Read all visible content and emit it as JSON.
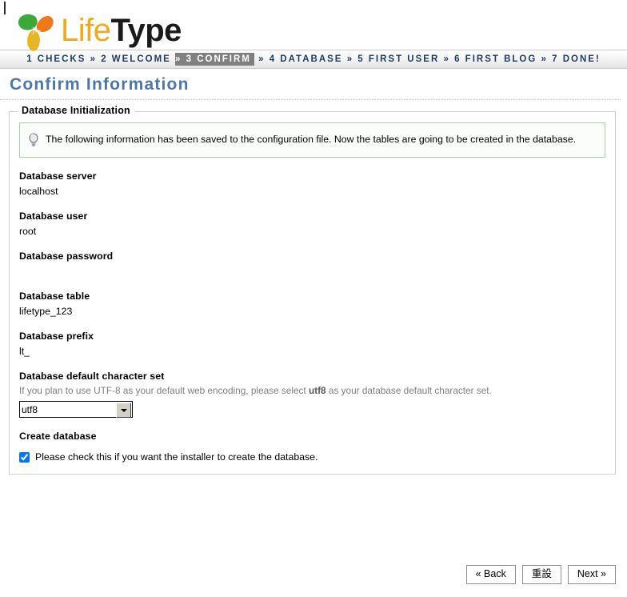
{
  "brand": {
    "name_part1": "Life",
    "name_part2": "Type",
    "logo_icon": "three-leaf-clover-icon",
    "colors": {
      "leaf_green": "#3aa93a",
      "leaf_orange": "#f07818",
      "leaf_gold": "#e8b526",
      "life": "#f0a91e",
      "type": "#1a1a1a"
    }
  },
  "steps": {
    "items": [
      {
        "label": "1 CHECKS",
        "active": false
      },
      {
        "label": "2 WELCOME",
        "active": false
      },
      {
        "label": "3 CONFIRM",
        "active": true
      },
      {
        "label": "4 DATABASE",
        "active": false
      },
      {
        "label": "5 FIRST USER",
        "active": false
      },
      {
        "label": "6 FIRST BLOG",
        "active": false
      },
      {
        "label": "7 DONE!",
        "active": false
      }
    ],
    "separator": "»",
    "active_bg": "#808080",
    "text_color": "#1f3b63"
  },
  "page": {
    "title": "Confirm Information"
  },
  "fieldset": {
    "legend": "Database Initialization",
    "info": {
      "icon": "lightbulb-icon",
      "text": "The following information has been saved to the configuration file. Now the tables are going to be created in the database.",
      "border_color": "#a8cfa8"
    },
    "fields": [
      {
        "label": "Database server",
        "value": "localhost"
      },
      {
        "label": "Database user",
        "value": "root"
      },
      {
        "label": "Database password",
        "value": ""
      },
      {
        "label": "Database table",
        "value": "lifetype_123"
      },
      {
        "label": "Database prefix",
        "value": "lt_"
      }
    ],
    "charset": {
      "label": "Database default character set",
      "hint_before": "If you plan to use UTF-8 as your default web encoding, please select ",
      "hint_bold": "utf8",
      "hint_after": " as your database default character set.",
      "selected": "utf8",
      "options": [
        "utf8"
      ]
    },
    "create_database": {
      "label": "Create database",
      "checkbox_label": "Please check this if you want the installer to create the database.",
      "checked": true
    }
  },
  "buttons": {
    "back": "« Back",
    "reset": "重設",
    "next": "Next »"
  }
}
